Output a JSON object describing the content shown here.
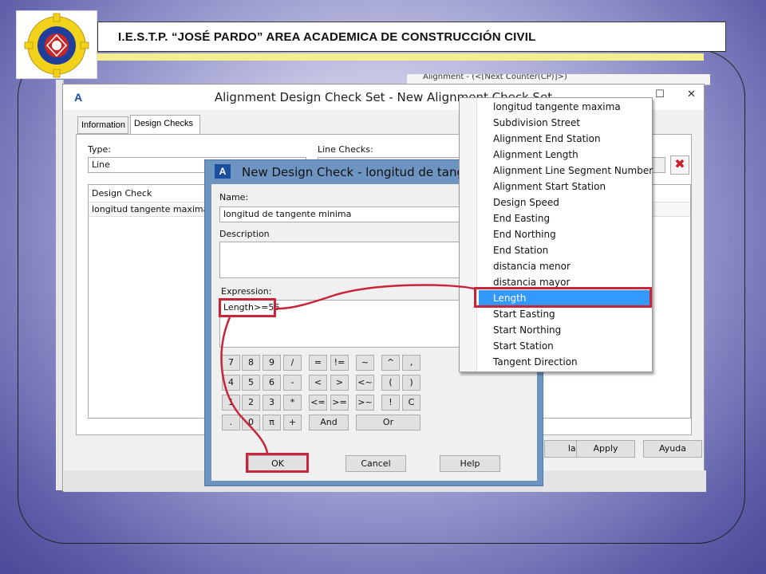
{
  "slide": {
    "header_title": "I.E.S.T.P. “JOSÉ PARDO” AREA ACADEMICA DE CONSTRUCCIÓN CIVIL"
  },
  "main_window": {
    "title": "Alignment Design Check Set - New Alignment Check Set",
    "tabs": [
      "Information",
      "Design Checks"
    ],
    "type_label": "Type:",
    "type_value": "Line",
    "line_checks_label": "Line Checks:",
    "list_header": "Design Check",
    "list_rows": [
      "longitud tangente maxima"
    ],
    "buttons": {
      "cancel_partial": "lar",
      "apply": "Apply",
      "help": "Ayuda"
    }
  },
  "child_dialog": {
    "title": "New Design Check - longitud de tangente minima",
    "name_label": "Name:",
    "name_value": "longitud de tangente minima",
    "description_label": "Description",
    "description_value": "",
    "expression_label": "Expression:",
    "expression_value": "Length>=56",
    "keypad": [
      [
        "7",
        "8",
        "9",
        "/",
        "=",
        "!=",
        "~",
        "^",
        ","
      ],
      [
        "4",
        "5",
        "6",
        "-",
        "<",
        ">",
        "<~",
        "(",
        ")"
      ],
      [
        "1",
        "2",
        "3",
        "*",
        "<=",
        ">=",
        ">~",
        "!",
        "C"
      ],
      [
        ".",
        "0",
        "π",
        "+",
        "And",
        "Or"
      ]
    ],
    "buttons": {
      "ok": "OK",
      "cancel": "Cancel",
      "help": "Help"
    }
  },
  "dropdown": {
    "items": [
      "longitud tangente maxima",
      "Subdivision Street",
      "Alignment End Station",
      "Alignment Length",
      "Alignment Line Segment Number",
      "Alignment Start Station",
      "Design Speed",
      "End Easting",
      "End Northing",
      "End Station",
      "distancia menor",
      "distancia mayor",
      "Length",
      "Start Easting",
      "Start Northing",
      "Start Station",
      "Tangent Direction"
    ],
    "selected": "Length"
  },
  "background_text": "Alignment - (<[Next Counter(CP)]>)",
  "colors": {
    "highlight_red": "#c7263a",
    "selection_blue": "#3399ff",
    "dialog_frame": "#6e95c2",
    "header_yellow": "#f3ef8e"
  }
}
